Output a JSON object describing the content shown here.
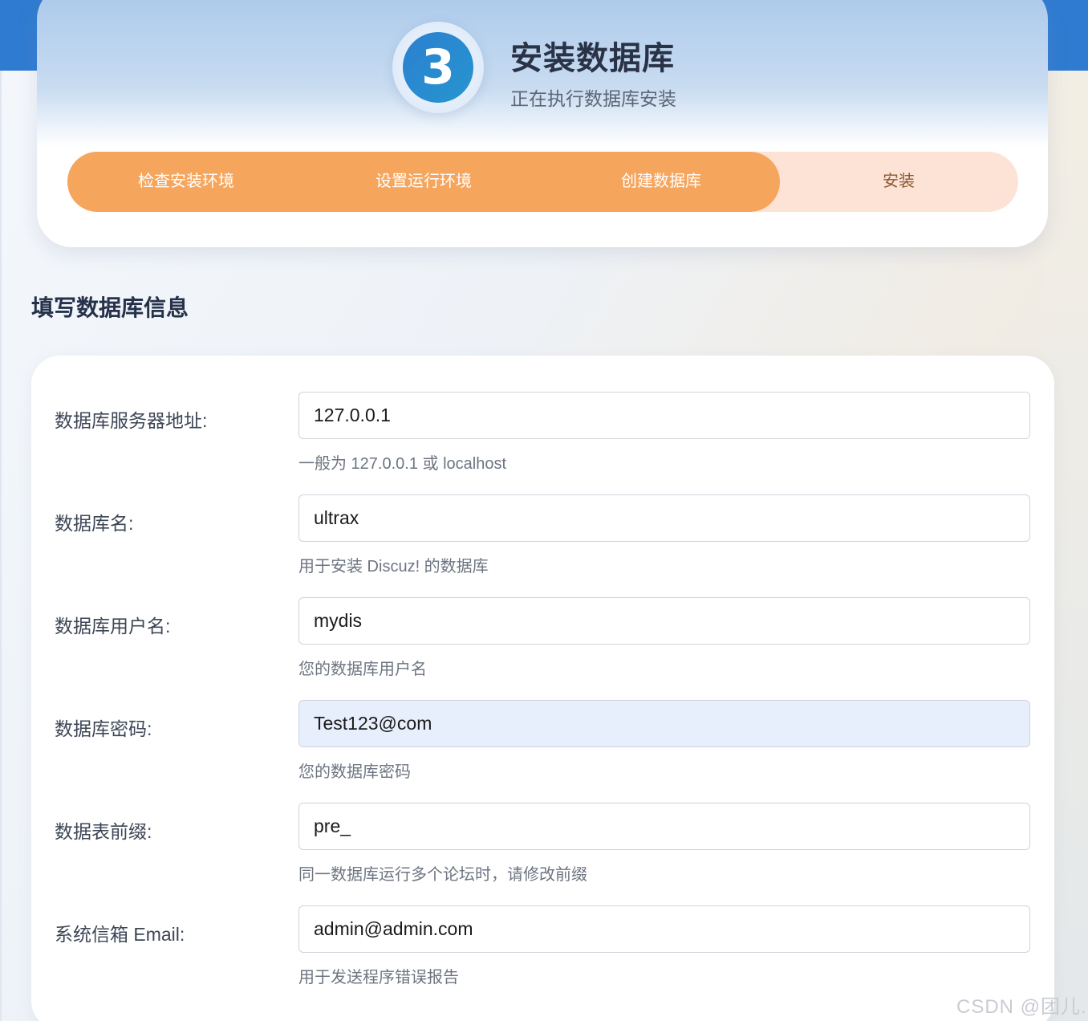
{
  "header": {
    "step_number": "3",
    "title": "安装数据库",
    "subtitle": "正在执行数据库安装"
  },
  "progress": {
    "steps": [
      {
        "label": "检查安装环境",
        "status": "done"
      },
      {
        "label": "设置运行环境",
        "status": "done"
      },
      {
        "label": "创建数据库",
        "status": "done"
      },
      {
        "label": "安装",
        "status": "pending"
      }
    ],
    "completed_fraction": 0.75
  },
  "section": {
    "title": "填写数据库信息"
  },
  "form": {
    "fields": [
      {
        "label": "数据库服务器地址:",
        "value": "127.0.0.1",
        "hint": "一般为 127.0.0.1 或 localhost"
      },
      {
        "label": "数据库名:",
        "value": "ultrax",
        "hint": "用于安装 Discuz! 的数据库"
      },
      {
        "label": "数据库用户名:",
        "value": "mydis",
        "hint": "您的数据库用户名"
      },
      {
        "label": "数据库密码:",
        "value": "Test123@com",
        "hint": "您的数据库密码"
      },
      {
        "label": "数据表前缀:",
        "value": "pre_",
        "hint": "同一数据库运行多个论坛时，请修改前缀"
      },
      {
        "label": "系统信箱 Email:",
        "value": "admin@admin.com",
        "hint": "用于发送程序错误报告"
      }
    ]
  },
  "watermark": "CSDN @团儿.",
  "colors": {
    "accent_blue": "#2f7bd1",
    "progress_done": "#f6a55d",
    "progress_pending": "#fde3d6",
    "autofill_bg": "#e8effc"
  }
}
